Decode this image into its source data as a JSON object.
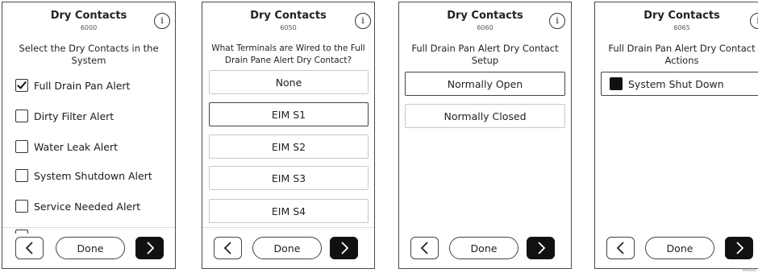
{
  "screens": [
    {
      "title": "Dry Contacts",
      "code": "6000",
      "prompt": "Select the Dry Contacts in the System",
      "checkboxes": [
        {
          "label": "Full Drain Pan Alert",
          "checked": true
        },
        {
          "label": "Dirty Filter Alert",
          "checked": false
        },
        {
          "label": "Water Leak Alert",
          "checked": false
        },
        {
          "label": "System Shutdown Alert",
          "checked": false
        },
        {
          "label": "Service Needed Alert",
          "checked": false
        }
      ],
      "done_label": "Done"
    },
    {
      "title": "Dry Contacts",
      "code": "6050",
      "prompt": "What Terminals are Wired to the Full Drain Pane Alert Dry Contact?",
      "options": [
        {
          "label": "None",
          "selected": false
        },
        {
          "label": "EIM S1",
          "selected": true
        },
        {
          "label": "EIM S2",
          "selected": false
        },
        {
          "label": "EIM S3",
          "selected": false
        },
        {
          "label": "EIM S4",
          "selected": false
        }
      ],
      "done_label": "Done"
    },
    {
      "title": "Dry Contacts",
      "code": "6060",
      "prompt": "Full Drain Pan Alert Dry Contact Setup",
      "options": [
        {
          "label": "Normally Open",
          "selected": true
        },
        {
          "label": "Normally Closed",
          "selected": false
        }
      ],
      "done_label": "Done"
    },
    {
      "title": "Dry Contacts",
      "code": "6065",
      "prompt": "Full Drain Pan Alert Dry Contact Actions",
      "checkboxes": [
        {
          "label": "System Shut Down",
          "checked": true
        }
      ],
      "done_label": "Done"
    }
  ],
  "info_icon_glyph": "i",
  "figure_id": "M4000"
}
